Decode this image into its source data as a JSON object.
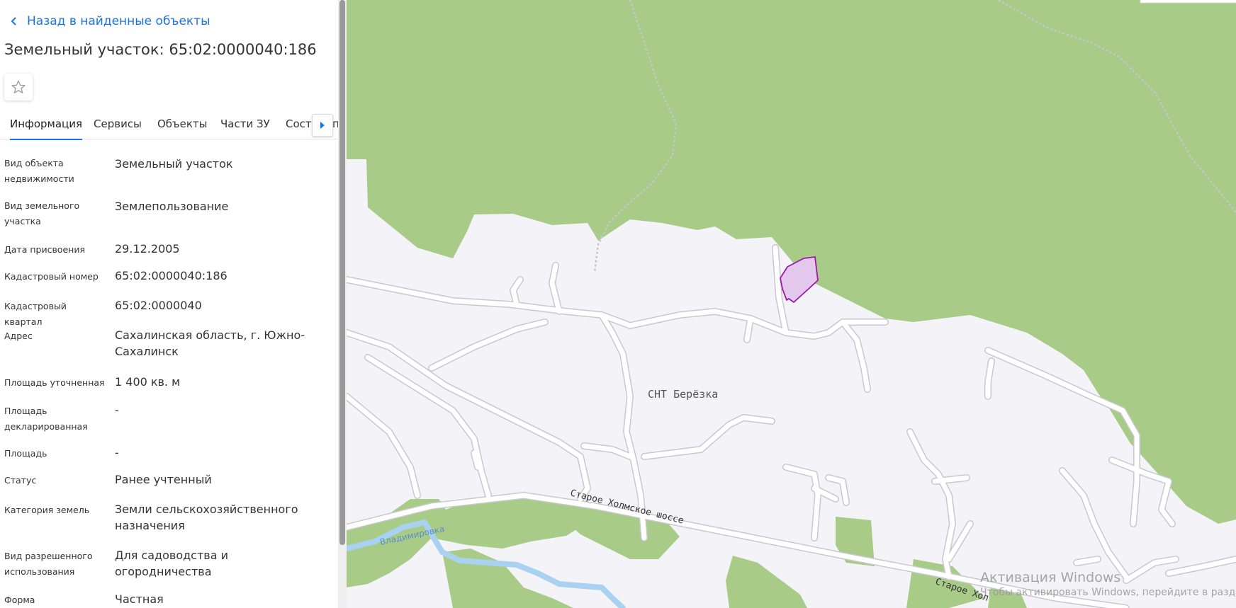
{
  "panel": {
    "back_label": "Назад в найденные объекты",
    "title": "Земельный участок: 65:02:0000040:186",
    "tabs": [
      "Информация",
      "Сервисы",
      "Объекты",
      "Части ЗУ",
      "Соста"
    ],
    "tab_tail": "п",
    "properties": [
      {
        "label": "Вид объекта недвижимости",
        "value": "Земельный участок"
      },
      {
        "label": "Вид земельного участка",
        "value": "Землепользование"
      },
      {
        "label": "Дата присвоения",
        "value": "29.12.2005"
      },
      {
        "label": "Кадастровый номер",
        "value": "65:02:0000040:186"
      },
      {
        "label": "Кадастровый квартал",
        "value": "65:02:0000040"
      },
      {
        "label": "Адрес",
        "value": "Сахалинская область, г. Южно-Сахалинск"
      },
      {
        "label": "Площадь уточненная",
        "value": "1 400 кв. м"
      },
      {
        "label": "Площадь декларированная",
        "value": "-"
      },
      {
        "label": "Площадь",
        "value": "-"
      },
      {
        "label": "Статус",
        "value": "Ранее учтенный"
      },
      {
        "label": "Категория земель",
        "value": "Земли сельскохозяйственного назначения"
      },
      {
        "label": "Вид разрешенного использования",
        "value": "Для садоводства и огородничества"
      },
      {
        "label": "Форма собственности",
        "value": "Частная"
      }
    ]
  },
  "map": {
    "area_label": "СНТ Берёзка",
    "road_label": "Старое Холмское шоссе",
    "road_label_2": "Старое Хол",
    "river_label": "Владимировка",
    "colors": {
      "forest": "#a8cc88",
      "urban": "#f4f3f8",
      "road": "#ffffff",
      "road_edge": "#c9c8d0",
      "river": "#a9d1f0",
      "parcel_fill": "#e4c7ec",
      "parcel_stroke": "#9b1aa8",
      "accent": "#1a73e8"
    }
  },
  "windows_watermark": {
    "line1": "Активация Windows",
    "line2": "Чтобы активировать Windows, перейдите в раздел"
  }
}
